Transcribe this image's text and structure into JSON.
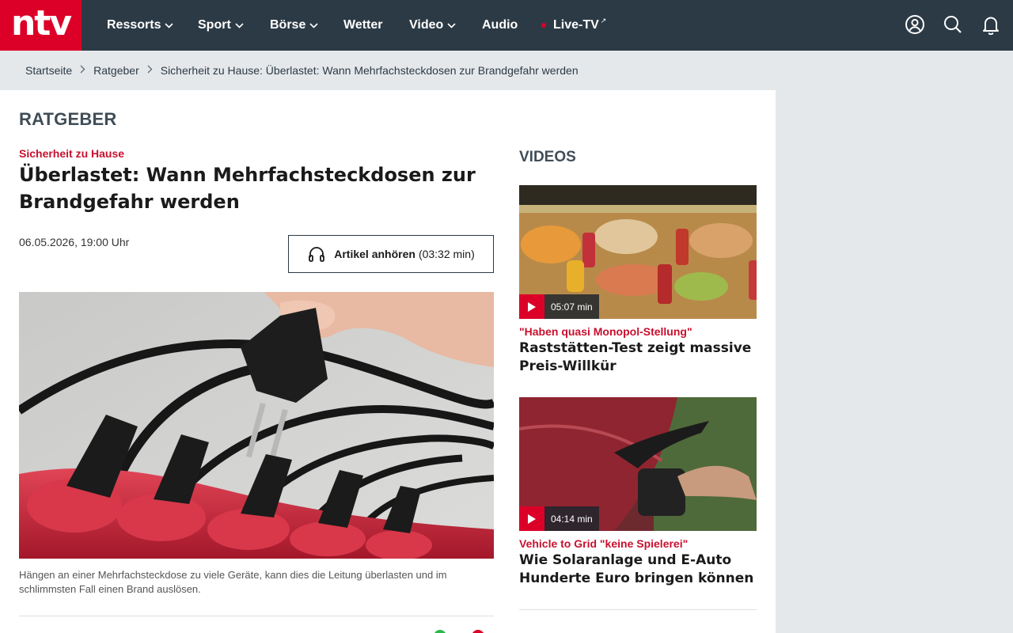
{
  "brand": {
    "logo_text": "ntv",
    "accent": "#dc0028",
    "nav_bg": "#2c3a45"
  },
  "nav": {
    "items": [
      {
        "label": "Ressorts",
        "has_dropdown": true
      },
      {
        "label": "Sport",
        "has_dropdown": true
      },
      {
        "label": "Börse",
        "has_dropdown": true
      },
      {
        "label": "Wetter",
        "has_dropdown": false
      },
      {
        "label": "Video",
        "has_dropdown": true
      },
      {
        "label": "Audio",
        "has_dropdown": false
      },
      {
        "label": "Live-TV",
        "has_dropdown": false
      }
    ],
    "icons": [
      "user-icon",
      "search-icon",
      "bell-icon"
    ]
  },
  "breadcrumb": {
    "items": [
      "Startseite",
      "Ratgeber",
      "Sicherheit zu Hause: Überlastet: Wann Mehrfachsteckdosen zur Brandgefahr werden"
    ]
  },
  "article": {
    "section": "RATGEBER",
    "kicker": "Sicherheit zu Hause",
    "headline": "Überlastet: Wann Mehrfachsteckdosen zur Brandgefahr werden",
    "date": "06.05.2026, 19:00 Uhr",
    "listen_label": "Artikel anhören",
    "listen_duration": "(03:32 min)",
    "caption": "Hängen an einer Mehrfachsteckdose zu viele Geräte, kann dies die Leitung überlasten und im schlimmsten Fall einen Brand auslösen."
  },
  "sidebar": {
    "title": "VIDEOS",
    "videos": [
      {
        "duration": "05:07 min",
        "kicker": "\"Haben quasi Monopol-Stellung\"",
        "title": "Raststätten-Test zeigt massive Preis-Willkür"
      },
      {
        "duration": "04:14 min",
        "kicker": "Vehicle to Grid \"keine Spielerei\"",
        "title": "Wie Solaranlage und E-Auto Hunderte Euro bringen können"
      }
    ]
  }
}
